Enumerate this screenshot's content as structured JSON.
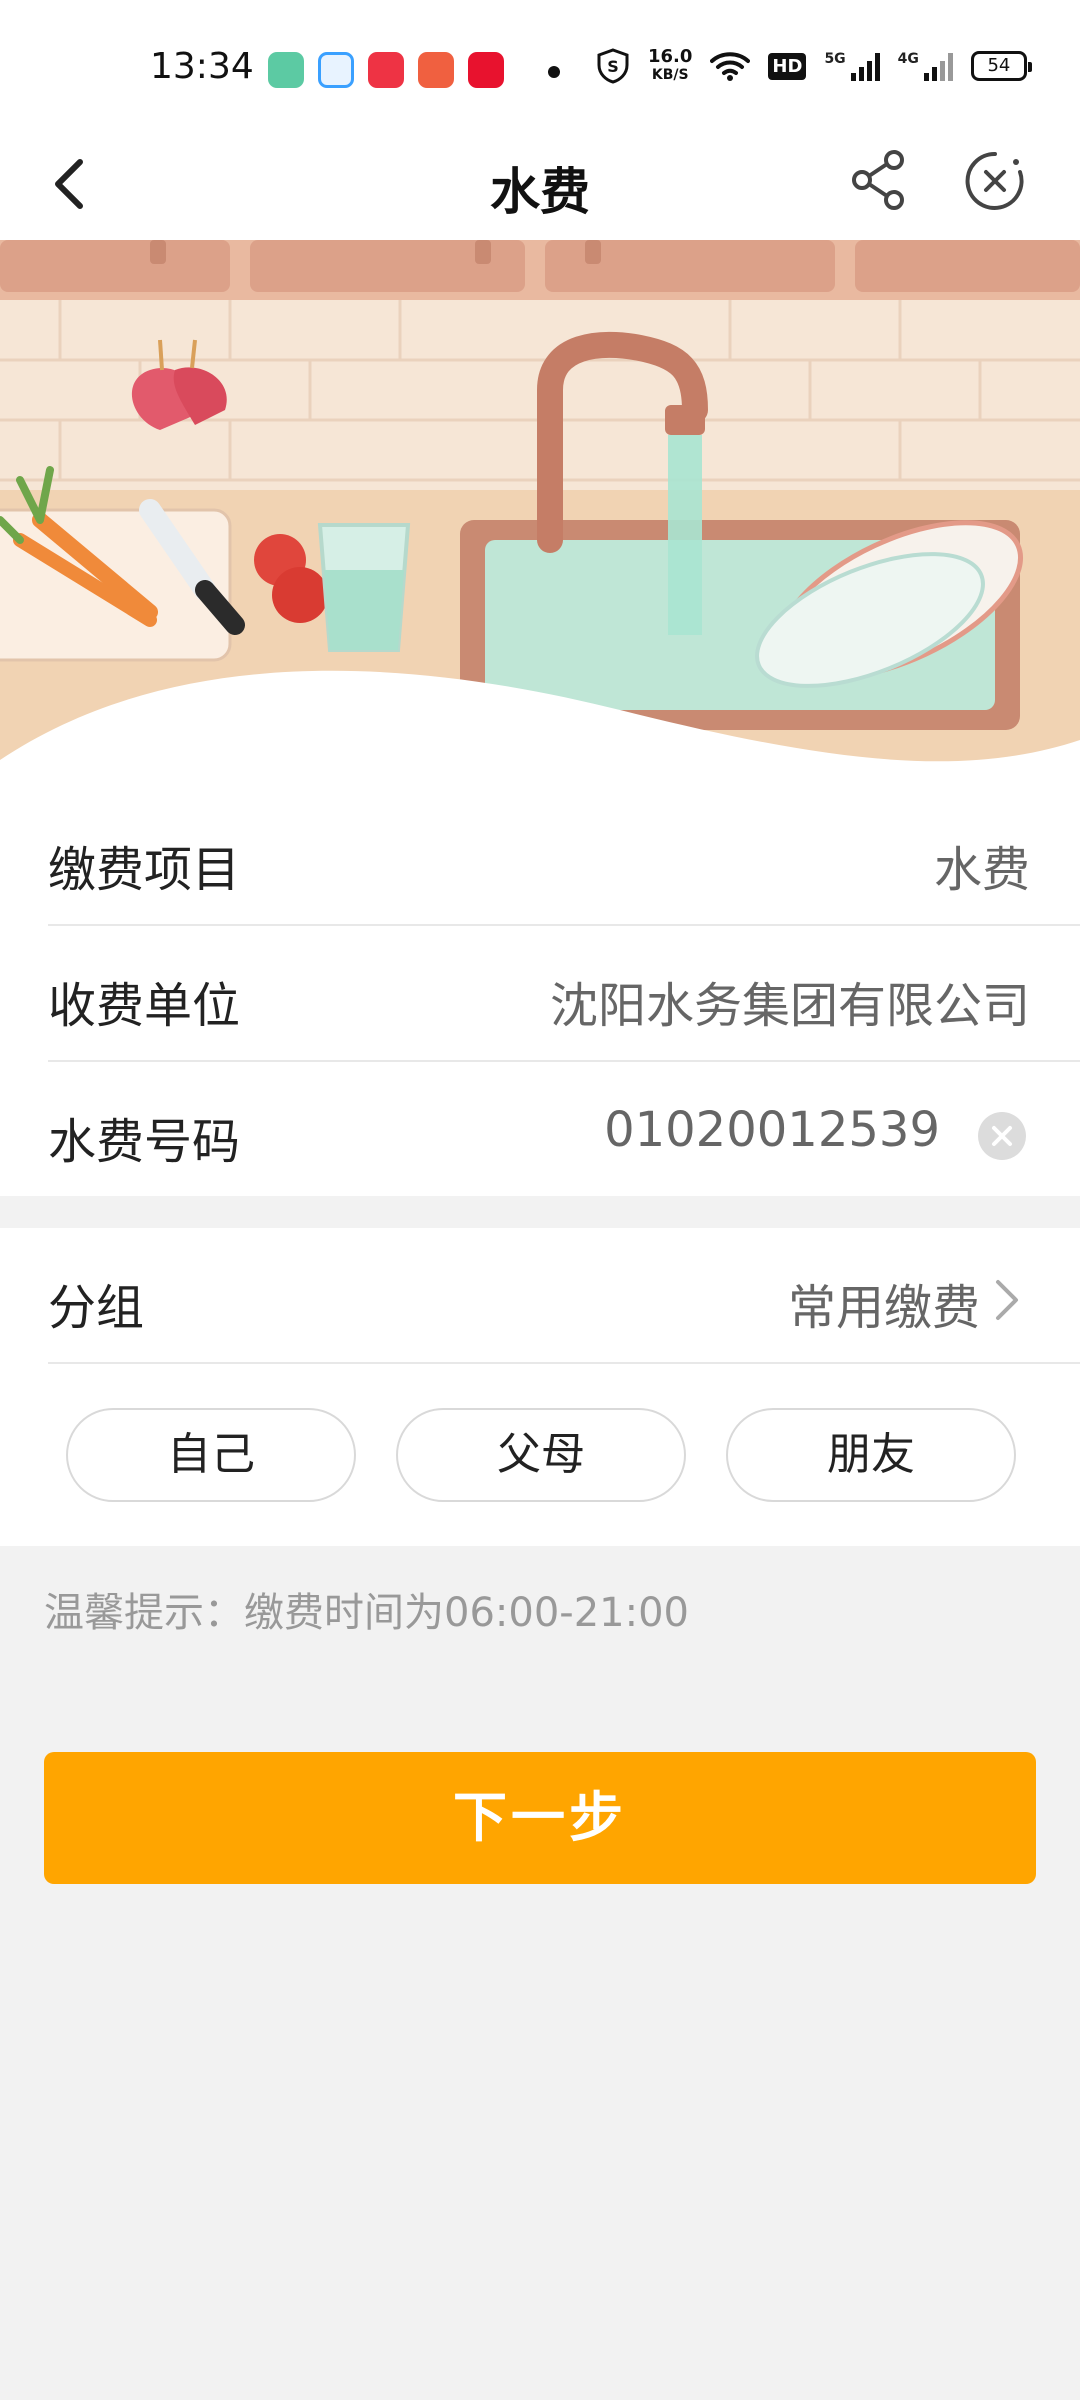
{
  "status_bar": {
    "time": "13:34",
    "net_speed": "16.0",
    "net_unit": "KB/S",
    "hd_label": "HD",
    "sig1_label": "5G",
    "sig2_label": "4G",
    "battery": "54"
  },
  "nav": {
    "title": "水费"
  },
  "form": {
    "item_label": "缴费项目",
    "item_value": "水费",
    "payee_label": "收费单位",
    "payee_value": "沈阳水务集团有限公司",
    "account_label": "水费号码",
    "account_value": "01020012539",
    "group_label": "分组",
    "group_value": "常用缴费"
  },
  "group_chips": [
    "自己",
    "父母",
    "朋友"
  ],
  "tip": "温馨提示：缴费时间为06:00-21:00",
  "next_button": "下一步",
  "colors": {
    "accent": "#ffa500",
    "background": "#f2f2f2"
  }
}
